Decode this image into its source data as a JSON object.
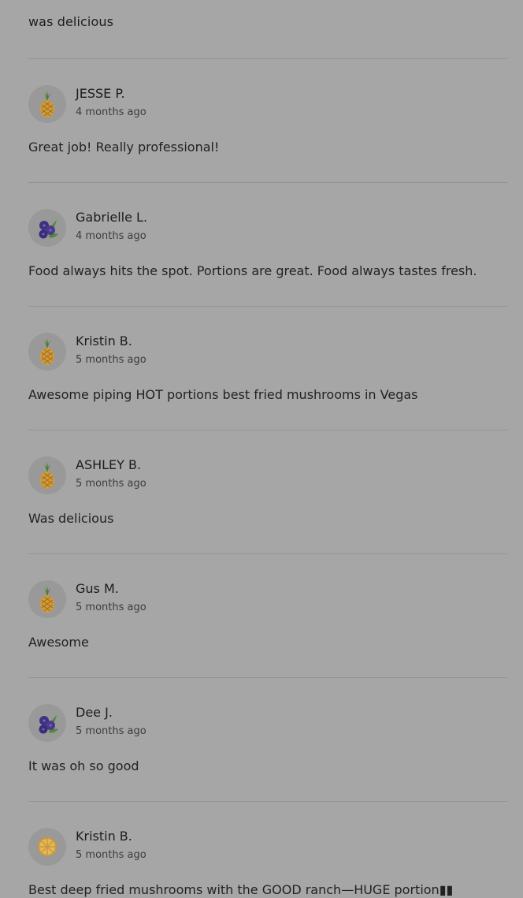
{
  "previous_review": {
    "text": "was delicious"
  },
  "reviews": [
    {
      "name": "JESSE P.",
      "time": "4 months ago",
      "text": "Great job! Really professional!",
      "avatar_icon": "pineapple-icon"
    },
    {
      "name": "Gabrielle L.",
      "time": "4 months ago",
      "text": "Food always hits the spot. Portions are great. Food always tastes fresh.",
      "avatar_icon": "blueberries-icon"
    },
    {
      "name": "Kristin B.",
      "time": "5 months ago",
      "text": "Awesome piping HOT portions best fried mushrooms in Vegas",
      "avatar_icon": "pineapple-icon"
    },
    {
      "name": "ASHLEY B.",
      "time": "5 months ago",
      "text": "Was delicious",
      "avatar_icon": "pineapple-icon"
    },
    {
      "name": "Gus M.",
      "time": "5 months ago",
      "text": "Awesome",
      "avatar_icon": "pineapple-icon"
    },
    {
      "name": "Dee J.",
      "time": "5 months ago",
      "text": "It was oh so good",
      "avatar_icon": "blueberries-icon"
    },
    {
      "name": "Kristin B.",
      "time": "5 months ago",
      "text": "Best deep fried mushrooms with the GOOD ranch—HUGE portion▮▮",
      "avatar_icon": "orange-slice-icon"
    }
  ],
  "colors": {
    "overlay_background": "#a6a6a6",
    "divider": "#949494",
    "pineapple_body": "#e0a43a",
    "pineapple_leaves": "#4f8a3a",
    "blueberry": "#4a3a8c",
    "orange_slice": "#e8b54a"
  }
}
